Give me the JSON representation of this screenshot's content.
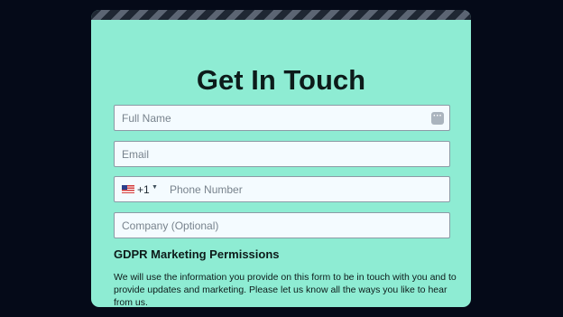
{
  "form": {
    "title": "Get In Touch",
    "full_name_placeholder": "Full Name",
    "email_placeholder": "Email",
    "phone_dial_code": "+1",
    "phone_country": "United States",
    "phone_placeholder": "Phone Number",
    "company_placeholder": "Company (Optional)",
    "gdpr_title": "GDPR Marketing Permissions",
    "gdpr_text": "We will use the information you provide on this form to be in touch with you and to provide updates and marketing. Please let us know all the ways you like to hear from us."
  },
  "icons": {
    "autofill": "more-dots-icon",
    "country_flag": "us-flag-icon",
    "dropdown": "caret-down-icon"
  },
  "colors": {
    "page_background": "#050a18",
    "card_background": "#8eecd3",
    "input_background": "#f4fbff"
  }
}
